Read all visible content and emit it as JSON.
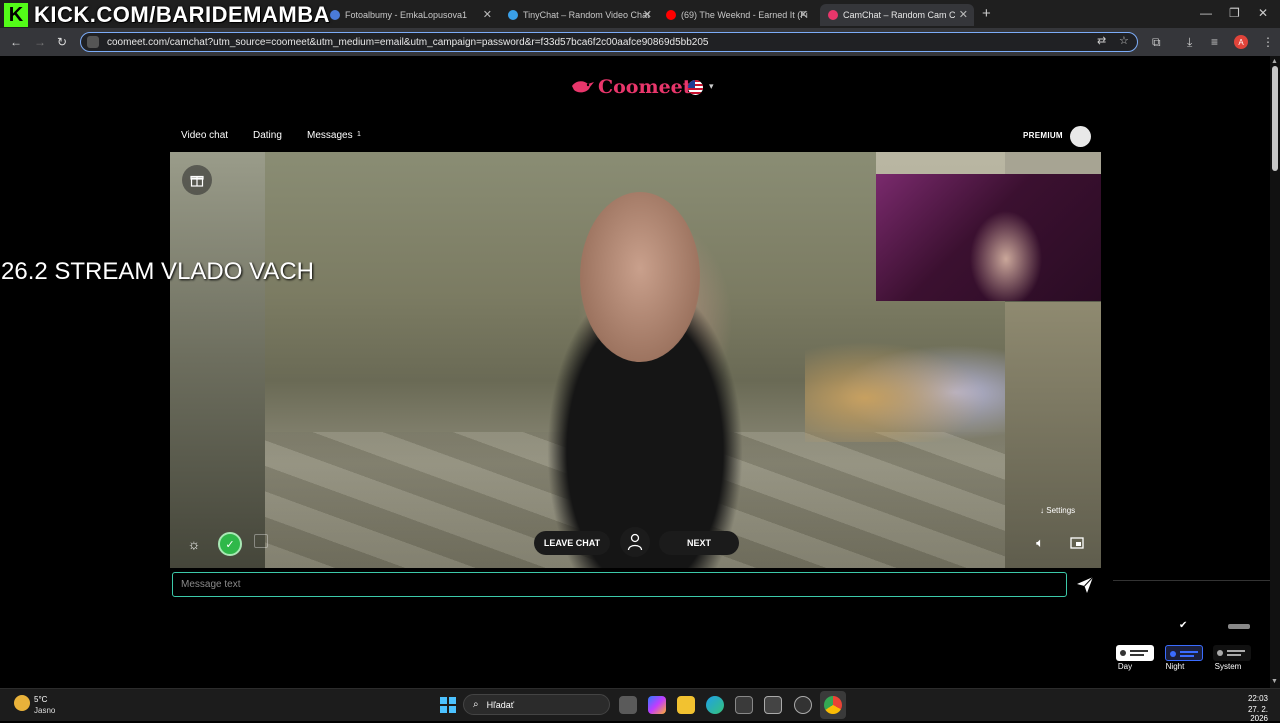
{
  "browser": {
    "tabs": [
      {
        "label": "Fotoalbumy - EmkaLopusova1",
        "favicon_color": "#4a7bd8"
      },
      {
        "label": "TinyChat – Random Video Chat",
        "favicon_color": "#3aa0e8"
      },
      {
        "label": "(69) The Weeknd - Earned It (Fi",
        "favicon_color": "#ff0000"
      },
      {
        "label": "CamChat – Random Cam Ch",
        "favicon_color": "#e8366b",
        "active": true
      }
    ],
    "url": "coomeet.com/camchat?utm_source=coomeet&utm_medium=email&utm_campaign=password&r=f33d57bca6f2c00aafce90869d5bb205",
    "profile_initial": "A"
  },
  "overlay": {
    "kick_text": "KICK.COM/BARIDEMAMBA",
    "stream_text": "26.2 STREAM VLADO VACH"
  },
  "site": {
    "logo_text": "Coomeet",
    "nav": {
      "video_chat": "Video chat",
      "dating": "Dating",
      "messages": "Messages",
      "messages_count": "1"
    },
    "premium": "PREMIUM"
  },
  "chat": {
    "leave_label": "LEAVE CHAT",
    "next_label": "NEXT",
    "settings_label": "Settings",
    "message_placeholder": "Message text"
  },
  "theme": {
    "options": [
      {
        "label": "Day"
      },
      {
        "label": "Night",
        "selected": true
      },
      {
        "label": "System"
      }
    ]
  },
  "taskbar": {
    "weather_temp": "5°C",
    "weather_condition": "Jasno",
    "search_placeholder": "Hľadať",
    "time": "22:03",
    "date": "27. 2. 2026"
  },
  "colors": {
    "brand": "#e8366b",
    "input_border": "#3cc9a9",
    "check_green": "#2fb84a",
    "kick_green": "#53fc18"
  }
}
